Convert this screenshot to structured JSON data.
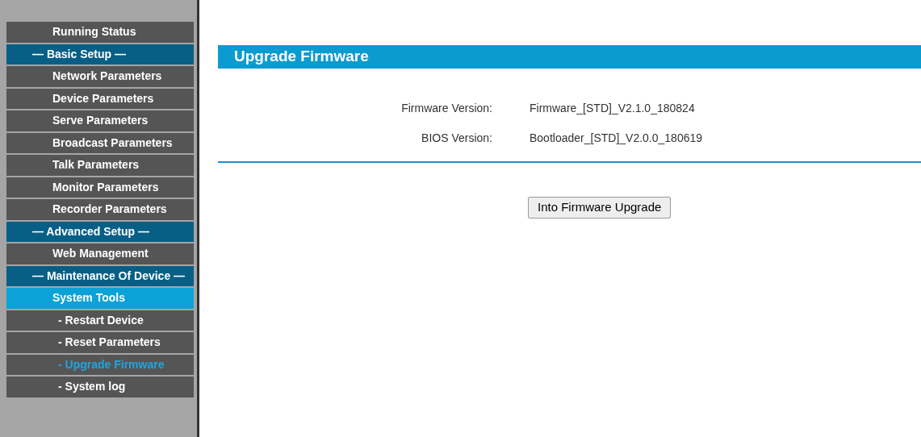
{
  "sidebar": {
    "items": [
      {
        "label": "Running Status",
        "kind": "item",
        "selected": false
      },
      {
        "label": "— Basic Setup —",
        "kind": "section",
        "selected": false
      },
      {
        "label": "Network Parameters",
        "kind": "item",
        "selected": false
      },
      {
        "label": "Device Parameters",
        "kind": "item",
        "selected": false
      },
      {
        "label": "Serve Parameters",
        "kind": "item",
        "selected": false
      },
      {
        "label": "Broadcast Parameters",
        "kind": "item",
        "selected": false
      },
      {
        "label": "Talk Parameters",
        "kind": "item",
        "selected": false
      },
      {
        "label": "Monitor Parameters",
        "kind": "item",
        "selected": false
      },
      {
        "label": "Recorder Parameters",
        "kind": "item",
        "selected": false
      },
      {
        "label": "— Advanced Setup —",
        "kind": "section",
        "selected": false
      },
      {
        "label": "Web Management",
        "kind": "item",
        "selected": false
      },
      {
        "label": "— Maintenance Of Device —",
        "kind": "section",
        "selected": false
      },
      {
        "label": "System Tools",
        "kind": "group",
        "selected": false
      },
      {
        "label": "- Restart Device",
        "kind": "subitem",
        "selected": false
      },
      {
        "label": "- Reset Parameters",
        "kind": "subitem",
        "selected": false
      },
      {
        "label": "- Upgrade Firmware",
        "kind": "subitem",
        "selected": true
      },
      {
        "label": "- System log",
        "kind": "subitem",
        "selected": false
      }
    ]
  },
  "main": {
    "title": "Upgrade Firmware",
    "fields": [
      {
        "label": "Firmware Version:",
        "value": "Firmware_[STD]_V2.1.0_180824"
      },
      {
        "label": "BIOS Version:",
        "value": "Bootloader_[STD]_V2.0.0_180619"
      }
    ],
    "button": "Into Firmware Upgrade"
  }
}
